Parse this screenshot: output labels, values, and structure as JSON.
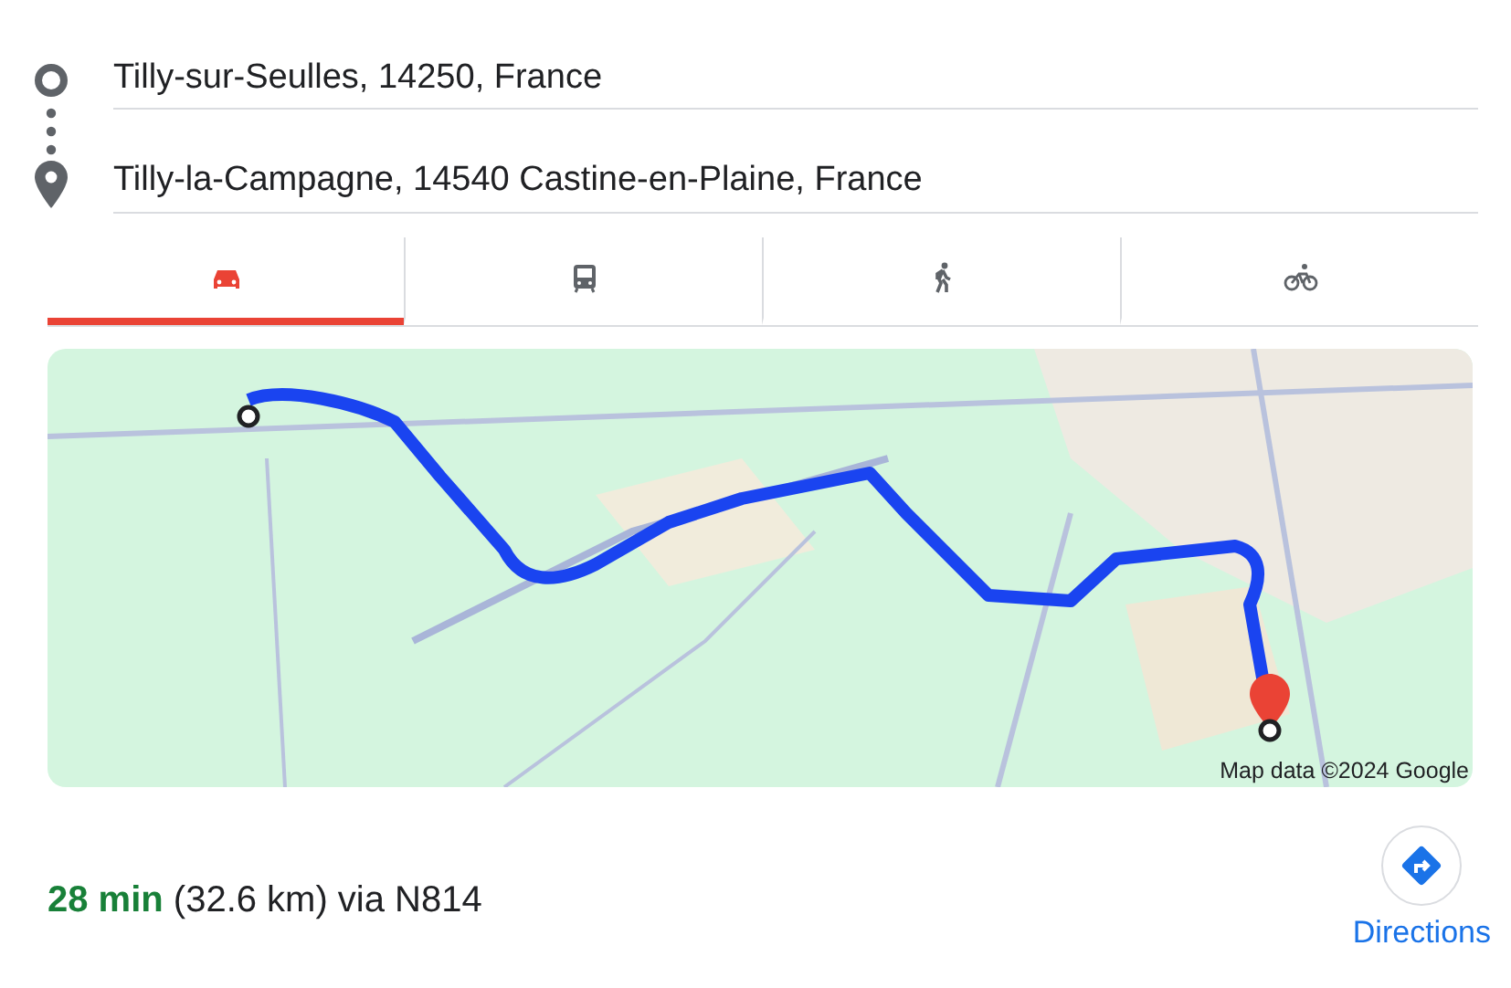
{
  "route": {
    "origin": "Tilly-sur-Seulles, 14250, France",
    "destination": "Tilly-la-Campagne, 14540 Castine-en-Plaine, France"
  },
  "tabs": [
    {
      "kind": "car",
      "selected": true
    },
    {
      "kind": "transit",
      "selected": false
    },
    {
      "kind": "walk",
      "selected": false
    },
    {
      "kind": "bike",
      "selected": false
    }
  ],
  "map": {
    "kind": "picture",
    "attribution": "Map data ©2024 Google"
  },
  "summary": "**28 min** (32.6 km) via N814",
  "directions_button": {
    "label": "Directions"
  }
}
